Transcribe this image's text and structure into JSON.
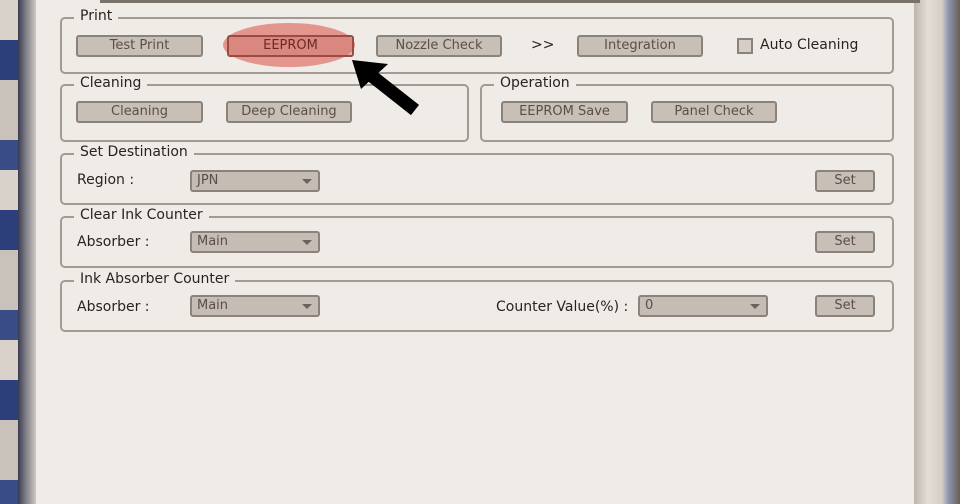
{
  "print": {
    "title": "Print",
    "test_print": "Test Print",
    "eeprom": "EEPROM",
    "nozzle_check": "Nozzle Check",
    "arrow_sep": ">>",
    "integration": "Integration",
    "auto_cleaning": "Auto Cleaning",
    "auto_cleaning_checked": false
  },
  "cleaning": {
    "title": "Cleaning",
    "cleaning": "Cleaning",
    "deep_cleaning": "Deep Cleaning"
  },
  "operation": {
    "title": "Operation",
    "eeprom_save": "EEPROM Save",
    "panel_check": "Panel Check"
  },
  "set_destination": {
    "title": "Set Destination",
    "region_label": "Region :",
    "region_value": "JPN",
    "set": "Set"
  },
  "clear_ink_counter": {
    "title": "Clear Ink Counter",
    "absorber_label": "Absorber :",
    "absorber_value": "Main",
    "set": "Set"
  },
  "ink_absorber_counter": {
    "title": "Ink Absorber Counter",
    "absorber_label": "Absorber :",
    "absorber_value": "Main",
    "counter_label": "Counter Value(%) :",
    "counter_value": "0",
    "set": "Set"
  },
  "annotation": {
    "highlight_color": "#e07a70",
    "arrow_color": "#000000"
  }
}
